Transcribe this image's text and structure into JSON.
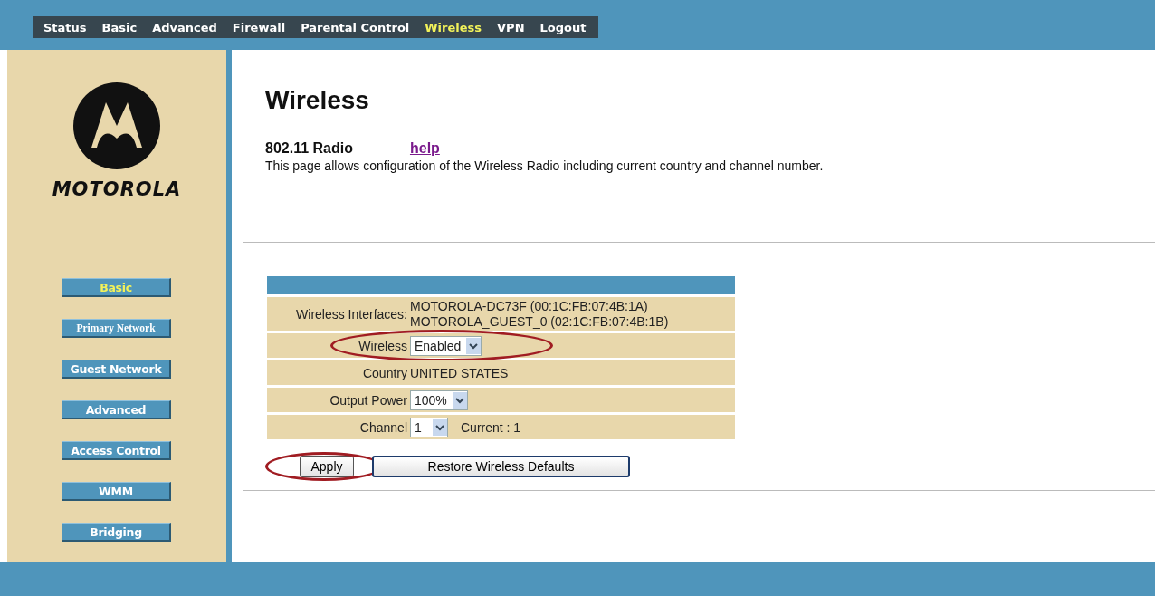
{
  "top_nav": [
    {
      "label": "Status",
      "selected": false
    },
    {
      "label": "Basic",
      "selected": false
    },
    {
      "label": "Advanced",
      "selected": false
    },
    {
      "label": "Firewall",
      "selected": false
    },
    {
      "label": "Parental Control",
      "selected": false
    },
    {
      "label": "Wireless",
      "selected": true
    },
    {
      "label": "VPN",
      "selected": false
    },
    {
      "label": "Logout",
      "selected": false
    }
  ],
  "brand": "MOTOROLA",
  "side_nav": [
    {
      "label": "Basic",
      "selected": true,
      "serif": false
    },
    {
      "label": "Primary Network",
      "selected": false,
      "serif": true
    },
    {
      "label": "Guest Network",
      "selected": false,
      "serif": false
    },
    {
      "label": "Advanced",
      "selected": false,
      "serif": false
    },
    {
      "label": "Access Control",
      "selected": false,
      "serif": false
    },
    {
      "label": "WMM",
      "selected": false,
      "serif": false
    },
    {
      "label": "Bridging",
      "selected": false,
      "serif": false
    }
  ],
  "page": {
    "title": "Wireless",
    "section": "802.11 Radio",
    "help_link": "help",
    "description": "This page allows configuration of the Wireless Radio including current country and channel number."
  },
  "settings": [
    {
      "kind": "text",
      "label": "Wireless Interfaces:",
      "values": [
        "MOTOROLA-DC73F (00:1C:FB:07:4B:1A)",
        "MOTOROLA_GUEST_0 (02:1C:FB:07:4B:1B)"
      ],
      "highlighted": false
    },
    {
      "kind": "select",
      "label": "Wireless",
      "value": "Enabled",
      "highlighted": true
    },
    {
      "kind": "text",
      "label": "Country",
      "values": [
        "UNITED STATES"
      ],
      "highlighted": false
    },
    {
      "kind": "select",
      "label": "Output Power",
      "value": "100%",
      "highlighted": false
    },
    {
      "kind": "select",
      "label": "Channel",
      "value": "1",
      "note": "Current : 1",
      "highlighted": false
    }
  ],
  "buttons": [
    {
      "label": "Apply",
      "highlighted": true
    },
    {
      "label": "Restore Wireless Defaults",
      "highlighted": false
    }
  ]
}
